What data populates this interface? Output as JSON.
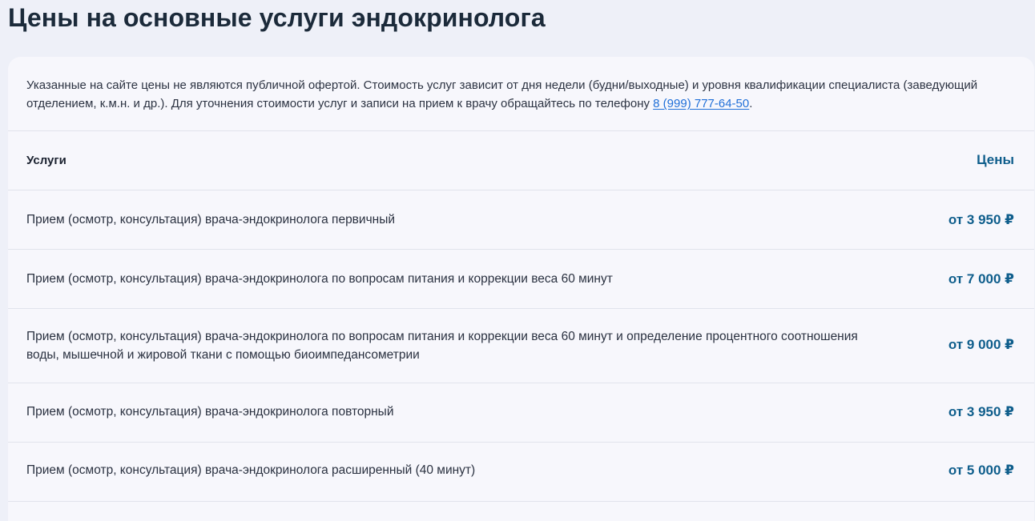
{
  "page": {
    "title": "Цены на основные услуги эндокринолога"
  },
  "notice": {
    "text_before": "Указанные на сайте цены не являются публичной офертой. Стоимость услуг зависит от дня недели (будни/выходные) и уровня квалификации специалиста (заведующий отделением, к.м.н. и др.). Для уточнения стоимости услуг и записи на прием к врачу обращайтесь по телефону ",
    "phone": "8 (999) 777-64-50",
    "text_after": "."
  },
  "table": {
    "header": {
      "services": "Услуги",
      "prices": "Цены"
    },
    "rows": [
      {
        "service": "Прием (осмотр, консультация) врача-эндокринолога первичный",
        "price": "от 3 950 ₽"
      },
      {
        "service": "Прием (осмотр, консультация) врача-эндокринолога по вопросам питания и коррекции веса 60 минут",
        "price": "от 7 000 ₽"
      },
      {
        "service": "Прием (осмотр, консультация) врача-эндокринолога по вопросам питания и коррекции веса 60 минут и определение процентного соотношения воды, мышечной и жировой ткани с помощью биоимпедансометрии",
        "price": "от 9 000 ₽"
      },
      {
        "service": "Прием (осмотр, консультация) врача-эндокринолога повторный",
        "price": "от 3 950 ₽"
      },
      {
        "service": "Прием (осмотр, консультация) врача-эндокринолога расширенный (40 минут)",
        "price": "от 5 000 ₽"
      }
    ]
  },
  "colors": {
    "background": "#eef0f8",
    "card": "#f7f7fc",
    "price_accent": "#0f5e8c",
    "link": "#1f6fd8",
    "divider": "#e1e3ec"
  }
}
